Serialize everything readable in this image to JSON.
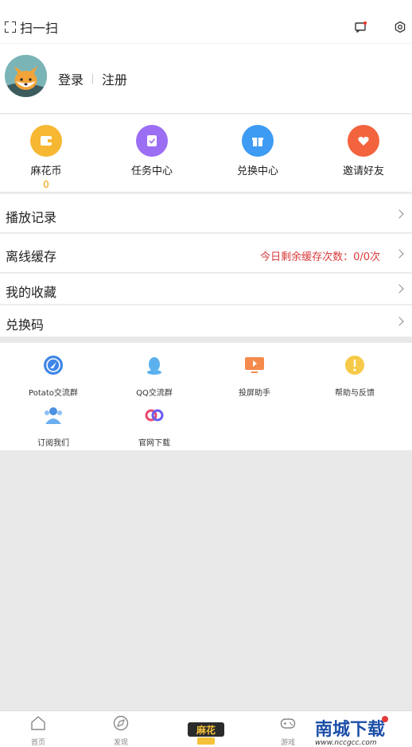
{
  "topbar": {
    "scan_label": "扫一扫"
  },
  "profile": {
    "login": "登录",
    "register": "注册"
  },
  "quick": [
    {
      "label": "麻花币",
      "value": "0",
      "color": "#f6b733",
      "icon": "wallet-icon"
    },
    {
      "label": "任务中心",
      "color": "#9b6ef3",
      "icon": "task-icon"
    },
    {
      "label": "兑换中心",
      "color": "#3d9bf3",
      "icon": "gift-icon"
    },
    {
      "label": "邀请好友",
      "color": "#f3633d",
      "icon": "heart-icon"
    }
  ],
  "menu": {
    "history": "播放记录",
    "offline": "离线缓存",
    "offline_info": "今日剩余缓存次数：0/0次",
    "favorites": "我的收藏",
    "redeem": "兑换码"
  },
  "tools": [
    {
      "label": "Potato交流群",
      "icon": "potato-icon"
    },
    {
      "label": "QQ交流群",
      "icon": "qq-icon"
    },
    {
      "label": "投屏助手",
      "icon": "cast-icon"
    },
    {
      "label": "帮助与反馈",
      "icon": "help-icon"
    },
    {
      "label": "订阅我们",
      "icon": "subscribe-icon"
    },
    {
      "label": "官网下载",
      "icon": "download-icon"
    }
  ],
  "tabbar": {
    "home": "首页",
    "discover": "发现",
    "games": "游戏"
  },
  "watermark": {
    "text": "南城下载",
    "url": "www.nccgcc.com"
  },
  "colors": {
    "accent": "#d83a3a",
    "coin": "#f2a007"
  }
}
